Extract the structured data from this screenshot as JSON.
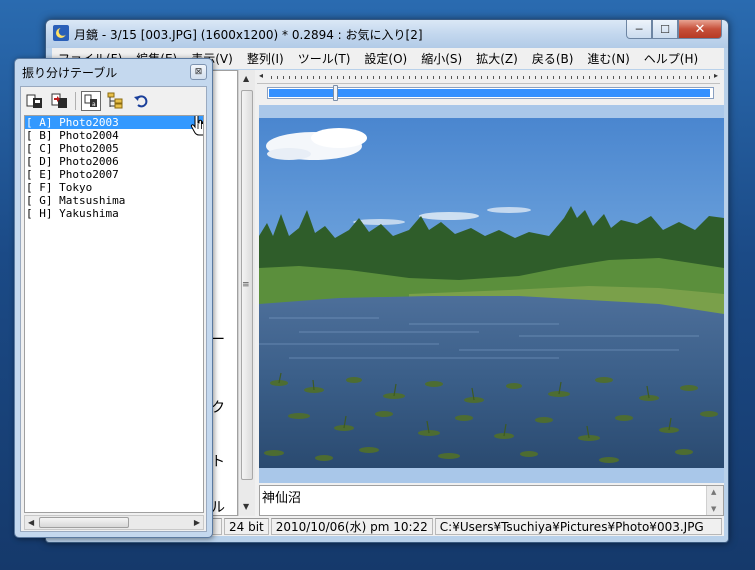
{
  "window": {
    "title": "月鏡 - 3/15 [003.JPG]  (1600x1200) * 0.2894  :  お気に入り[2]",
    "minimize_glyph": "─",
    "maximize_glyph": "☐",
    "close_glyph": "✕"
  },
  "menu": [
    "ファイル(F)",
    "編集(E)",
    "表示(V)",
    "整列(I)",
    "ツール(T)",
    "設定(O)",
    "縮小(S)",
    "拡大(Z)",
    "戻る(B)",
    "進む(N)",
    "ヘルプ(H)"
  ],
  "left_pane_fragments": [
    "ー",
    "ク",
    "ト",
    "ル"
  ],
  "zoom": {
    "progress_fraction": 0.99,
    "marker_fraction": 0.145
  },
  "caption": "神仙沼",
  "status": {
    "bit_depth": "24 bit",
    "datetime": "2010/10/06(水) pm 10:22",
    "path": "C:¥Users¥Tsuchiya¥Pictures¥Photo¥003.JPG"
  },
  "palette": {
    "title": "振り分けテーブル",
    "close_glyph": "⊠",
    "tools": [
      "copy-to-folder-icon",
      "move-to-folder-icon",
      "rename-icon",
      "folder-tree-icon",
      "undo-icon"
    ],
    "items": [
      "[ A] Photo2003",
      "[ B] Photo2004",
      "[ C] Photo2005",
      "[ D] Photo2006",
      "[ E] Photo2007",
      "[ F] Tokyo",
      "[ G] Matsushima",
      "[ H] Yakushima"
    ],
    "selected_index": 0
  },
  "colors": {
    "selection": "#3399ff",
    "progress": "#3390ff",
    "image_border": "#a9c7e9"
  }
}
